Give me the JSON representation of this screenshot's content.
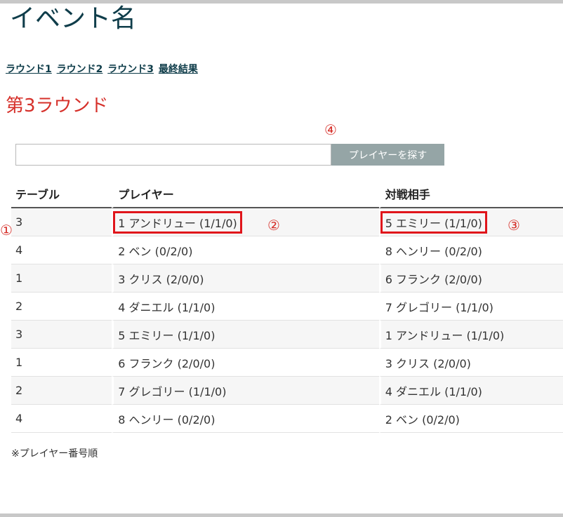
{
  "event": {
    "title": "イベント名"
  },
  "nav": {
    "rounds": [
      "ラウンド1",
      "ラウンド2",
      "ラウンド3",
      "最終結果"
    ]
  },
  "round": {
    "heading": "第3ラウンド"
  },
  "search": {
    "placeholder": "",
    "button_label": "プレイヤーを探す"
  },
  "markers": {
    "m1": "①",
    "m2": "②",
    "m3": "③",
    "m4": "④"
  },
  "table": {
    "headers": {
      "table": "テーブル",
      "player": "プレイヤー",
      "opponent": "対戦相手"
    },
    "rows": [
      {
        "table": "3",
        "player": "1 アンドリュー (1/1/0)",
        "opponent": "5 エミリー (1/1/0)"
      },
      {
        "table": "4",
        "player": "2 ベン (0/2/0)",
        "opponent": "8 ヘンリー (0/2/0)"
      },
      {
        "table": "1",
        "player": "3 クリス (2/0/0)",
        "opponent": "6 フランク (2/0/0)"
      },
      {
        "table": "2",
        "player": "4 ダニエル (1/1/0)",
        "opponent": "7 グレゴリー (1/1/0)"
      },
      {
        "table": "3",
        "player": "5 エミリー (1/1/0)",
        "opponent": "1 アンドリュー (1/1/0)"
      },
      {
        "table": "1",
        "player": "6 フランク (2/0/0)",
        "opponent": "3 クリス (2/0/0)"
      },
      {
        "table": "2",
        "player": "7 グレゴリー (1/1/0)",
        "opponent": "4 ダニエル (1/1/0)"
      },
      {
        "table": "4",
        "player": "8 ヘンリー (0/2/0)",
        "opponent": "2 ベン (0/2/0)"
      }
    ]
  },
  "footnote": "※プレイヤー番号順",
  "colors": {
    "title": "#0f3d4a",
    "heading": "#d6302a",
    "highlight": "#e0151b",
    "button": "#95a5a6"
  }
}
